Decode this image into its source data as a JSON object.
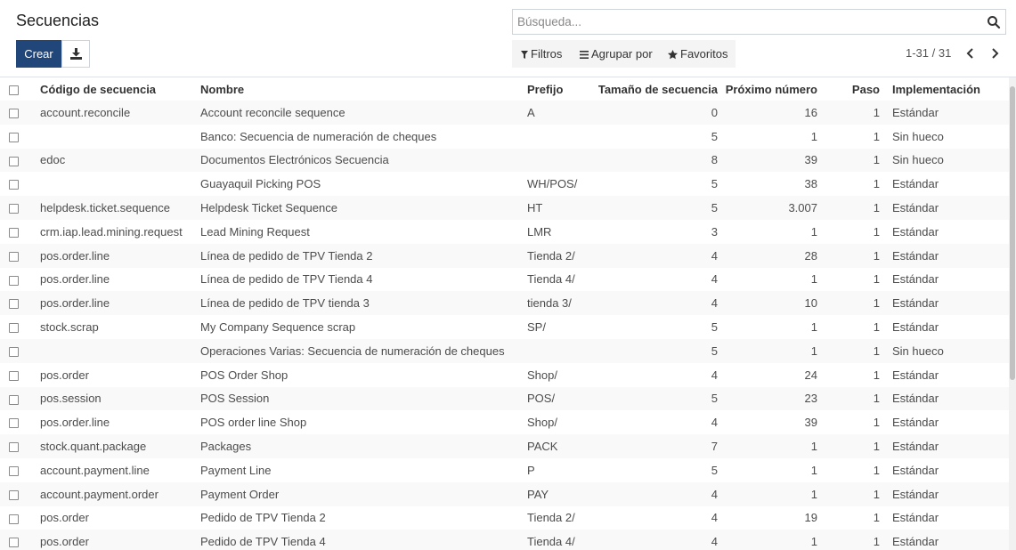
{
  "page": {
    "title": "Secuencias"
  },
  "search": {
    "placeholder": "Búsqueda..."
  },
  "buttons": {
    "create_label": "Crear"
  },
  "search_options": {
    "filters_label": "Filtros",
    "group_by_label": "Agrupar por",
    "favorites_label": "Favoritos"
  },
  "pager": {
    "value": "1-31 / 31"
  },
  "table": {
    "headers": {
      "code": "Código de secuencia",
      "name": "Nombre",
      "prefix": "Prefijo",
      "size": "Tamaño de secuencia",
      "next": "Próximo número",
      "step": "Paso",
      "implementation": "Implementación"
    },
    "rows": [
      {
        "code": "account.reconcile",
        "name": "Account reconcile sequence",
        "prefix": "A",
        "size": "0",
        "next": "16",
        "step": "1",
        "implementation": "Estándar"
      },
      {
        "code": "",
        "name": "Banco: Secuencia de numeración de cheques",
        "prefix": "",
        "size": "5",
        "next": "1",
        "step": "1",
        "implementation": "Sin hueco"
      },
      {
        "code": "edoc",
        "name": "Documentos Electrónicos Secuencia",
        "prefix": "",
        "size": "8",
        "next": "39",
        "step": "1",
        "implementation": "Sin hueco"
      },
      {
        "code": "",
        "name": "Guayaquil Picking POS",
        "prefix": "WH/POS/",
        "size": "5",
        "next": "38",
        "step": "1",
        "implementation": "Estándar"
      },
      {
        "code": "helpdesk.ticket.sequence",
        "name": "Helpdesk Ticket Sequence",
        "prefix": "HT",
        "size": "5",
        "next": "3.007",
        "step": "1",
        "implementation": "Estándar"
      },
      {
        "code": "crm.iap.lead.mining.request",
        "name": "Lead Mining Request",
        "prefix": "LMR",
        "size": "3",
        "next": "1",
        "step": "1",
        "implementation": "Estándar"
      },
      {
        "code": "pos.order.line",
        "name": "Línea de pedido de TPV Tienda 2",
        "prefix": "Tienda 2/",
        "size": "4",
        "next": "28",
        "step": "1",
        "implementation": "Estándar"
      },
      {
        "code": "pos.order.line",
        "name": "Línea de pedido de TPV Tienda 4",
        "prefix": "Tienda 4/",
        "size": "4",
        "next": "1",
        "step": "1",
        "implementation": "Estándar"
      },
      {
        "code": "pos.order.line",
        "name": "Línea de pedido de TPV tienda 3",
        "prefix": "tienda 3/",
        "size": "4",
        "next": "10",
        "step": "1",
        "implementation": "Estándar"
      },
      {
        "code": "stock.scrap",
        "name": "My Company Sequence scrap",
        "prefix": "SP/",
        "size": "5",
        "next": "1",
        "step": "1",
        "implementation": "Estándar"
      },
      {
        "code": "",
        "name": "Operaciones Varias: Secuencia de numeración de cheques",
        "prefix": "",
        "size": "5",
        "next": "1",
        "step": "1",
        "implementation": "Sin hueco"
      },
      {
        "code": "pos.order",
        "name": "POS Order Shop",
        "prefix": "Shop/",
        "size": "4",
        "next": "24",
        "step": "1",
        "implementation": "Estándar"
      },
      {
        "code": "pos.session",
        "name": "POS Session",
        "prefix": "POS/",
        "size": "5",
        "next": "23",
        "step": "1",
        "implementation": "Estándar"
      },
      {
        "code": "pos.order.line",
        "name": "POS order line Shop",
        "prefix": "Shop/",
        "size": "4",
        "next": "39",
        "step": "1",
        "implementation": "Estándar"
      },
      {
        "code": "stock.quant.package",
        "name": "Packages",
        "prefix": "PACK",
        "size": "7",
        "next": "1",
        "step": "1",
        "implementation": "Estándar"
      },
      {
        "code": "account.payment.line",
        "name": "Payment Line",
        "prefix": "P",
        "size": "5",
        "next": "1",
        "step": "1",
        "implementation": "Estándar"
      },
      {
        "code": "account.payment.order",
        "name": "Payment Order",
        "prefix": "PAY",
        "size": "4",
        "next": "1",
        "step": "1",
        "implementation": "Estándar"
      },
      {
        "code": "pos.order",
        "name": "Pedido de TPV Tienda 2",
        "prefix": "Tienda 2/",
        "size": "4",
        "next": "19",
        "step": "1",
        "implementation": "Estándar"
      },
      {
        "code": "pos.order",
        "name": "Pedido de TPV Tienda 4",
        "prefix": "Tienda 4/",
        "size": "4",
        "next": "1",
        "step": "1",
        "implementation": "Estándar"
      }
    ]
  },
  "colors": {
    "primary": "#21467a",
    "row_stripe": "#f9f9f9",
    "options_bg": "#f4f4f4"
  },
  "icons": {
    "search": "search-icon",
    "download": "download-icon",
    "filter": "filter-icon",
    "group": "group-by-icon",
    "favorite": "star-icon",
    "prev": "chevron-left-icon",
    "next": "chevron-right-icon"
  }
}
